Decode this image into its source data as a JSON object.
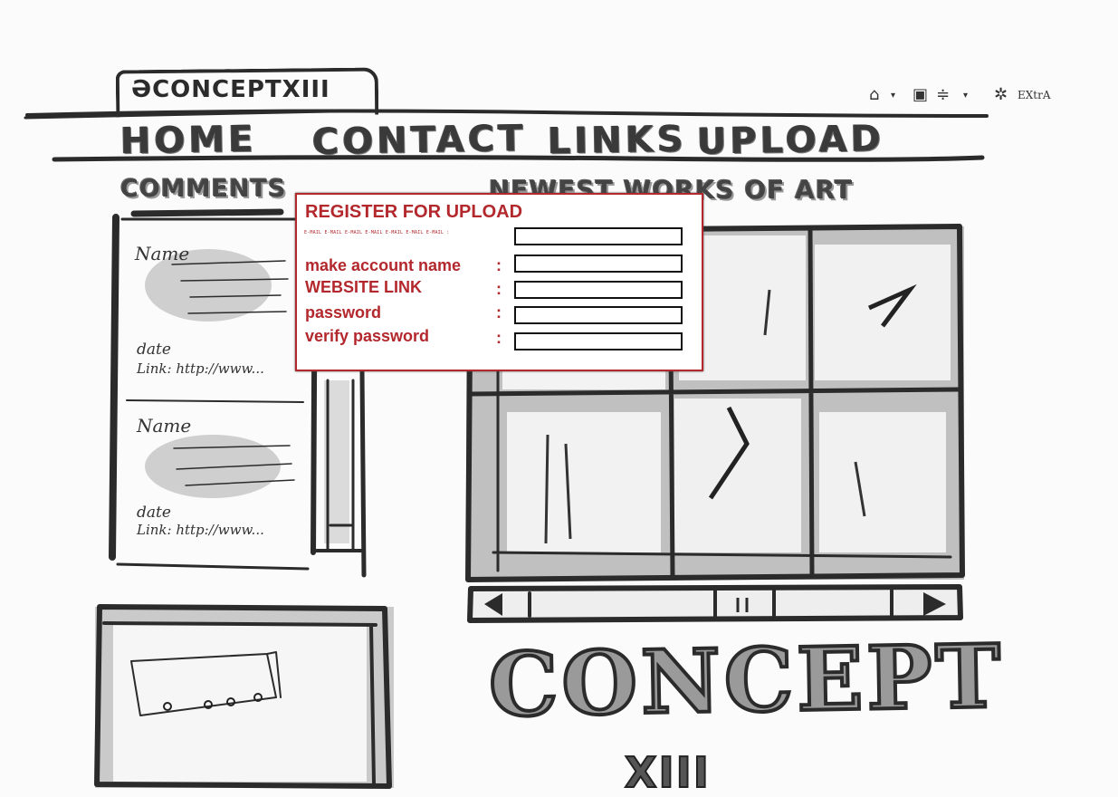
{
  "header": {
    "site_tab": "ƏCONCEPTXIII",
    "icons": [
      "home-icon",
      "save-icon",
      "tools-icon",
      "settings-icon"
    ],
    "extra_label": "EXtrA"
  },
  "nav": {
    "items": [
      "HOME",
      "CONTACT",
      "LINKS",
      "UPLOAD"
    ]
  },
  "comments": {
    "title": "COMMENTS",
    "entries": [
      {
        "name": "Name",
        "date": "date",
        "link": "Link: http://www..."
      },
      {
        "name": "Name",
        "date": "date",
        "link": "Link: http://www..."
      }
    ]
  },
  "gallery": {
    "title": "NEWEST WORKS OF ART"
  },
  "register": {
    "title": "REGISTER FOR UPLOAD",
    "email_label": "E-MAIL E-MAIL E-MAIL E-MAIL E-MAIL E-MAIL E-MAIL   :",
    "fields": [
      {
        "label": "make account name",
        "value": ""
      },
      {
        "label": "WEBSITE LINK",
        "value": ""
      },
      {
        "label": "password",
        "value": ""
      },
      {
        "label": "verify password",
        "value": ""
      }
    ]
  },
  "logo": {
    "main": "CONCEPT",
    "sub": "XIII"
  },
  "colors": {
    "ink": "#2b2b2b",
    "wash": "#8a8a8a",
    "accent": "#b3282d"
  }
}
